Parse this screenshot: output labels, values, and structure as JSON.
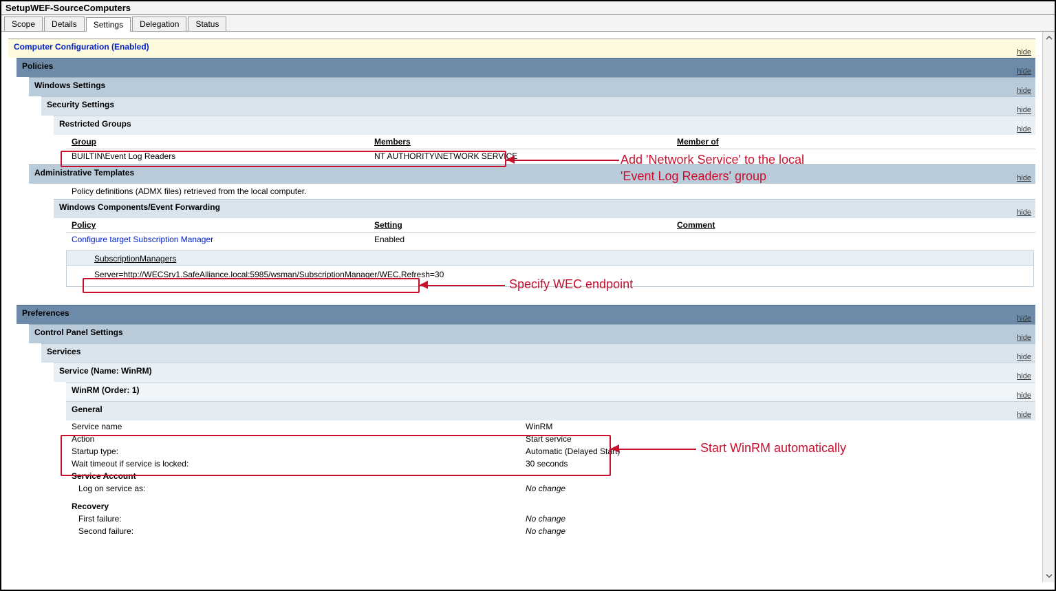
{
  "window_title": "SetupWEF-SourceComputers",
  "tabs": [
    "Scope",
    "Details",
    "Settings",
    "Delegation",
    "Status"
  ],
  "active_tab": "Settings",
  "hide_label": "hide",
  "sections": {
    "computer_config": "Computer Configuration (Enabled)",
    "policies": "Policies",
    "windows_settings": "Windows Settings",
    "security_settings": "Security Settings",
    "restricted_groups": "Restricted Groups",
    "admin_templates": "Administrative Templates",
    "admx_note": "Policy definitions (ADMX files) retrieved from the local computer.",
    "win_components": "Windows Components/Event Forwarding",
    "preferences": "Preferences",
    "control_panel": "Control Panel Settings",
    "services": "Services",
    "service_winrm": "Service (Name: WinRM)",
    "winrm_order": "WinRM (Order: 1)",
    "general": "General"
  },
  "restricted_table": {
    "headers": {
      "group": "Group",
      "members": "Members",
      "member_of": "Member of"
    },
    "row": {
      "group": "BUILTIN\\Event Log Readers",
      "members": "NT AUTHORITY\\NETWORK SERVICE",
      "member_of": ""
    }
  },
  "policy_table": {
    "headers": {
      "policy": "Policy",
      "setting": "Setting",
      "comment": "Comment"
    },
    "row": {
      "policy": "Configure target Subscription Manager",
      "setting": "Enabled",
      "comment": ""
    },
    "sub_header": "SubscriptionManagers",
    "sub_value": "Server=http://WECSrv1.SafeAlliance.local:5985/wsman/SubscriptionManager/WEC,Refresh=30"
  },
  "service_props": {
    "service_name": {
      "label": "Service name",
      "value": "WinRM"
    },
    "action": {
      "label": "Action",
      "value": "Start service"
    },
    "startup": {
      "label": "Startup type:",
      "value": "Automatic (Delayed Start)"
    },
    "wait": {
      "label": "Wait timeout if service is locked:",
      "value": "30 seconds"
    },
    "account_hdr": "Service Account",
    "logon": {
      "label": "Log on service as:",
      "value": "No change"
    },
    "recovery_hdr": "Recovery",
    "first": {
      "label": "First failure:",
      "value": "No change"
    },
    "second": {
      "label": "Second failure:",
      "value": "No change"
    }
  },
  "annotations": {
    "a1_line1": "Add 'Network Service' to the local",
    "a1_line2": "'Event Log Readers' group",
    "a2": "Specify WEC endpoint",
    "a3": "Start WinRM automatically"
  }
}
